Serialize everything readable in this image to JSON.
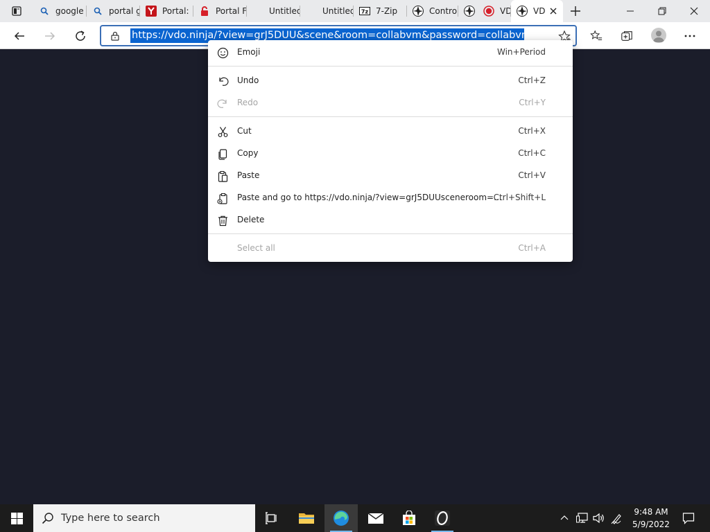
{
  "tabs": [
    {
      "title": "google",
      "icon": "search-icon"
    },
    {
      "title": "portal g",
      "icon": "search-icon"
    },
    {
      "title": "Portal: ",
      "icon": "portal-red-y-icon"
    },
    {
      "title": "Portal F",
      "icon": "portal-red-lock-icon"
    },
    {
      "title": "Untitled",
      "icon": "blank-page-icon"
    },
    {
      "title": "Untitled",
      "icon": "blank-page-icon"
    },
    {
      "title": "7-Zip",
      "icon": "7zip-icon"
    },
    {
      "title": "Control",
      "icon": "vdo-ninja-icon"
    },
    {
      "title": "",
      "icon": "vdo-ninja-icon"
    },
    {
      "title": "VD",
      "icon": "record-icon"
    },
    {
      "title": "VD",
      "icon": "vdo-ninja-icon"
    }
  ],
  "address": {
    "url": "https://vdo.ninja/?view=grJ5DUU&scene&room=collabvm&password=collabvm"
  },
  "context_menu": {
    "items": [
      {
        "label": "Emoji",
        "shortcut": "Win+Period",
        "icon": "emoji-icon",
        "disabled": false
      },
      {
        "label": "Undo",
        "shortcut": "Ctrl+Z",
        "icon": "undo-icon",
        "disabled": false
      },
      {
        "label": "Redo",
        "shortcut": "Ctrl+Y",
        "icon": "redo-icon",
        "disabled": true
      },
      {
        "label": "Cut",
        "shortcut": "Ctrl+X",
        "icon": "scissors-icon",
        "disabled": false
      },
      {
        "label": "Copy",
        "shortcut": "Ctrl+C",
        "icon": "copy-icon",
        "disabled": false
      },
      {
        "label": "Paste",
        "shortcut": "Ctrl+V",
        "icon": "paste-icon",
        "disabled": false
      },
      {
        "label": "Paste and go to https://vdo.ninja/?view=grJ5DUUsceneroom=...",
        "shortcut": "Ctrl+Shift+L",
        "icon": "paste-go-icon",
        "disabled": false
      },
      {
        "label": "Delete",
        "shortcut": "",
        "icon": "trash-icon",
        "disabled": false
      },
      {
        "label": "Select all",
        "shortcut": "Ctrl+A",
        "icon": "",
        "disabled": true
      }
    ]
  },
  "taskbar": {
    "search_placeholder": "Type here to search",
    "time": "9:48 AM",
    "date": "5/9/2022"
  },
  "colors": {
    "page_background": "#1b1d2a",
    "selection": "#0a64d0",
    "taskbar": "#1c1c1c"
  }
}
